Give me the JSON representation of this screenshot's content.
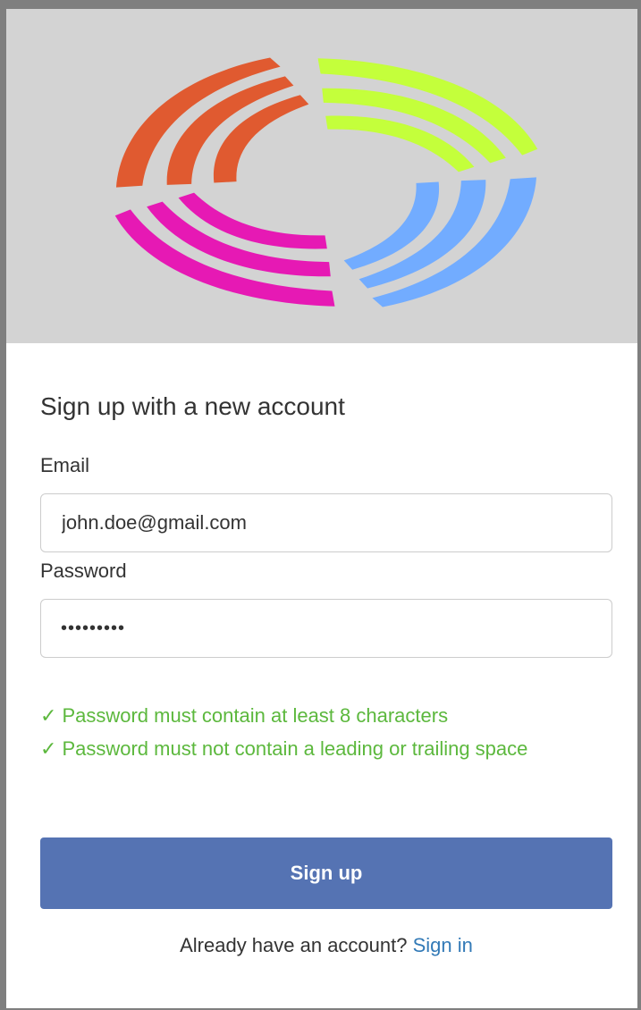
{
  "banner": {
    "logo_icon": "swirl-logo-icon",
    "background_color": "#d3d3d3",
    "logo_colors": {
      "orange": "#e05a30",
      "lime": "#c4ff3b",
      "blue": "#72acff",
      "magenta": "#e619b4"
    }
  },
  "form": {
    "heading": "Sign up with a new account",
    "email_label": "Email",
    "email_value": "john.doe@gmail.com",
    "password_label": "Password",
    "password_masked": "•••••••••"
  },
  "validation": {
    "color": "#5cb83d",
    "check_icon": "check-icon",
    "rules": [
      {
        "check": "✓",
        "text": "Password must contain at least 8 characters"
      },
      {
        "check": "✓",
        "text": "Password must not contain a leading or trailing space"
      }
    ]
  },
  "actions": {
    "signup_label": "Sign up",
    "signup_color": "#5573b3"
  },
  "footer": {
    "prompt": "Already have an account?",
    "signin_label": "Sign in"
  }
}
